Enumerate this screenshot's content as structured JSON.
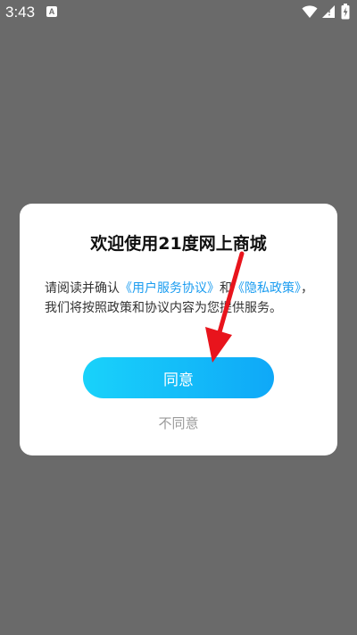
{
  "status_bar": {
    "time": "3:43",
    "notification_icon": "A",
    "icons": [
      "wifi-icon",
      "signal-icon",
      "battery-icon"
    ]
  },
  "dialog": {
    "title": "欢迎使用21度网上商城",
    "body": {
      "intro": "请阅读并确认",
      "user_agreement_link": "《用户服务协议》",
      "and": "和",
      "privacy_link": "《隐私政策》",
      "outro": "，我们将按照政策和协议内容为您提供服务。"
    },
    "agree_label": "同意",
    "disagree_label": "不同意"
  },
  "colors": {
    "overlay": "#6a6a6a",
    "link": "#1a9cf0",
    "button_gradient_start": "#19d2fa",
    "button_gradient_end": "#0fa8f8",
    "annotation_arrow": "#e8141c"
  }
}
